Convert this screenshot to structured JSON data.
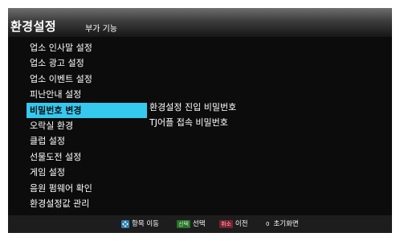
{
  "header": {
    "title": "환경설정",
    "subtitle": "부가 기능"
  },
  "menu": {
    "items": [
      {
        "label": "업소 인사말 설정"
      },
      {
        "label": "업소 광고 설정"
      },
      {
        "label": "업소 이벤트 설정"
      },
      {
        "label": "피난안내 설정"
      },
      {
        "label": "비밀번호 변경",
        "selected": true
      },
      {
        "label": "오락실 환경"
      },
      {
        "label": "클럽 설정"
      },
      {
        "label": "선물도전 설정"
      },
      {
        "label": "게임 설정"
      },
      {
        "label": "음원 펌웨어 확인"
      },
      {
        "label": "환경설정값 관리"
      }
    ],
    "selected_color": "#35c9f0"
  },
  "submenu": {
    "items": [
      {
        "label": "환경설정 진입 비밀번호"
      },
      {
        "label": "TJ어플 접속 비밀번호"
      }
    ]
  },
  "footer": {
    "move_icon": "navpad-icon",
    "move_label": "항목 이동",
    "select_key": "선택",
    "select_label": "선택",
    "cancel_key": "취소",
    "cancel_label": "이전",
    "reset_key": "0",
    "reset_label": "초기화면"
  }
}
